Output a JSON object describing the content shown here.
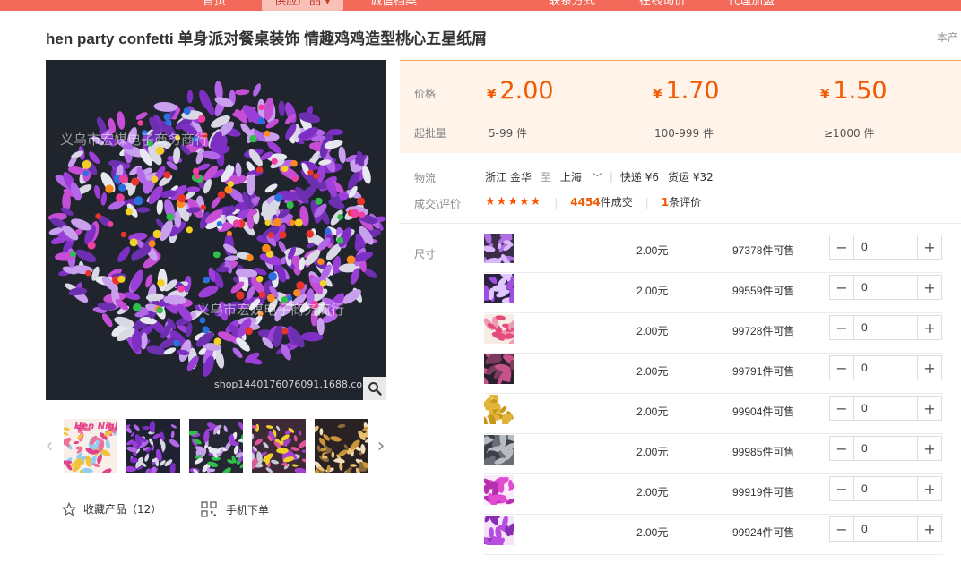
{
  "nav": {
    "items": [
      {
        "label": "首页",
        "active": false
      },
      {
        "label": "供应产品",
        "active": true
      },
      {
        "label": "诚信档案",
        "active": false
      },
      {
        "label": "联系方式",
        "active": false
      },
      {
        "label": "在线询价",
        "active": false
      },
      {
        "label": "代理加盟",
        "active": false
      }
    ]
  },
  "product": {
    "title": "hen party confetti 单身派对餐桌装饰 情趣鸡鸡造型桃心五星纸屑",
    "side_note": "本产",
    "watermark_1": "义乌市宏媒电子商务商行",
    "watermark_2": "义乌市宏媒电子商务商行",
    "watermark_url": "shop1440176076091.1688.com",
    "thumb_hen_label": "Hen Night"
  },
  "actions": {
    "favorite_label": "收藏产品（12）",
    "mobile_label": "手机下单"
  },
  "pricing": {
    "price_label": "价格",
    "moq_label": "起批量",
    "currency": "¥",
    "tiers": [
      {
        "price": "2.00",
        "range": "5-99 件"
      },
      {
        "price": "1.70",
        "range": "100-999 件"
      },
      {
        "price": "1.50",
        "range": "≥1000 件"
      }
    ],
    "accent": "#f15a00"
  },
  "logistics": {
    "label": "物流",
    "from": "浙江 金华",
    "to_word": "至",
    "to": "上海",
    "express": "快递 ¥6",
    "freight": "货运 ¥32"
  },
  "rating": {
    "label": "成交\\评价",
    "stars": "★★★★★",
    "deals_count": "4454",
    "deals_suffix": "件成交",
    "reviews_count": "1",
    "reviews_suffix": "条评价"
  },
  "sku": {
    "label": "尺寸",
    "rows": [
      {
        "price": "2.00元",
        "stock": "97378件可售",
        "qty": "0"
      },
      {
        "price": "2.00元",
        "stock": "99559件可售",
        "qty": "0"
      },
      {
        "price": "2.00元",
        "stock": "99728件可售",
        "qty": "0"
      },
      {
        "price": "2.00元",
        "stock": "99791件可售",
        "qty": "0"
      },
      {
        "price": "2.00元",
        "stock": "99904件可售",
        "qty": "0"
      },
      {
        "price": "2.00元",
        "stock": "99985件可售",
        "qty": "0"
      },
      {
        "price": "2.00元",
        "stock": "99919件可售",
        "qty": "0"
      },
      {
        "price": "2.00元",
        "stock": "99924件可售",
        "qty": "0"
      }
    ]
  }
}
